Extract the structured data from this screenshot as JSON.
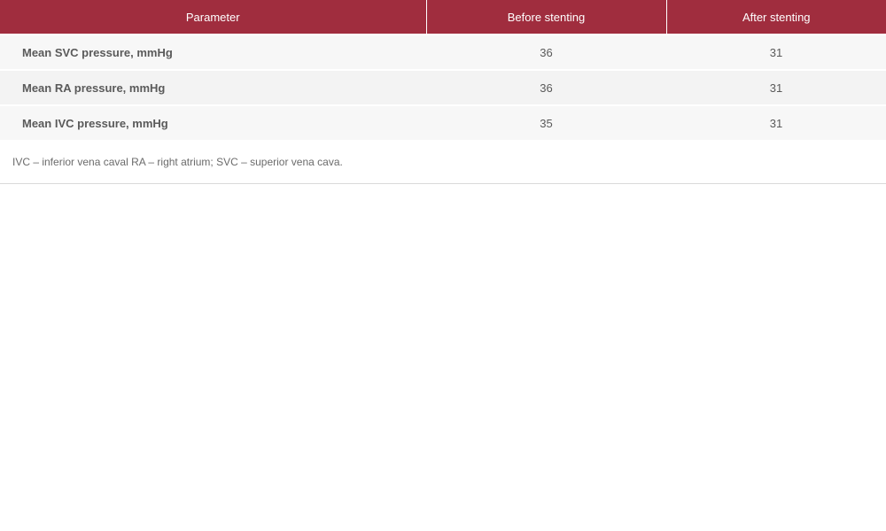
{
  "table": {
    "headers": [
      "Parameter",
      "Before stenting",
      "After stenting"
    ],
    "rows": [
      {
        "parameter": "Mean SVC pressure, mmHg",
        "before": "36",
        "after": "31"
      },
      {
        "parameter": "Mean RA pressure, mmHg",
        "before": "36",
        "after": "31"
      },
      {
        "parameter": "Mean IVC pressure, mmHg",
        "before": "35",
        "after": "31"
      }
    ],
    "footnote": "IVC – inferior vena caval RA – right atrium; SVC – superior vena cava."
  }
}
